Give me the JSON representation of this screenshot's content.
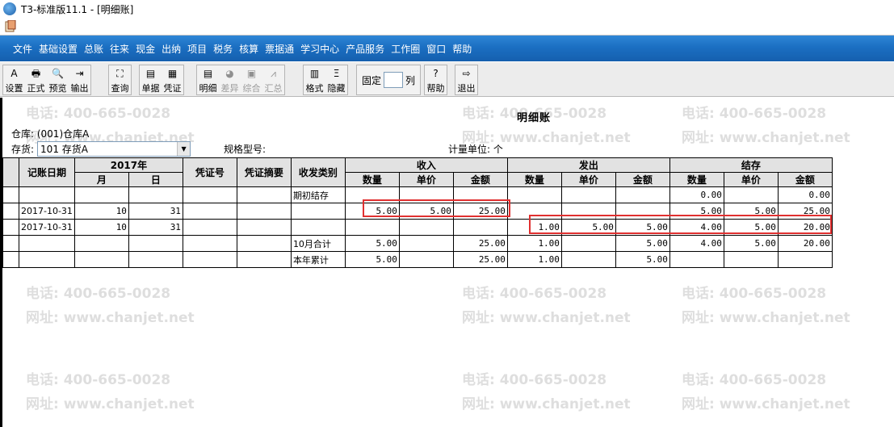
{
  "window": {
    "title": "T3-标准版11.1 - [明细账]"
  },
  "menu": [
    "文件",
    "基础设置",
    "总账",
    "往来",
    "现金",
    "出纳",
    "项目",
    "税务",
    "核算",
    "票据通",
    "学习中心",
    "产品服务",
    "工作圈",
    "窗口",
    "帮助"
  ],
  "toolbar": {
    "group1": [
      {
        "label": "设置",
        "icon": "A"
      },
      {
        "label": "正式",
        "icon": "🖶"
      },
      {
        "label": "预览",
        "icon": "🔍"
      },
      {
        "label": "输出",
        "icon": "⇥"
      }
    ],
    "group2": [
      {
        "label": "查询",
        "icon": "⛶"
      }
    ],
    "group3": [
      {
        "label": "单据",
        "icon": "▤"
      },
      {
        "label": "凭证",
        "icon": "▦"
      }
    ],
    "group4": [
      {
        "label": "明细",
        "icon": "▤"
      },
      {
        "label": "差异",
        "icon": "◕",
        "disabled": true
      },
      {
        "label": "综合",
        "icon": "▣",
        "disabled": true
      },
      {
        "label": "汇总",
        "icon": "⩘",
        "disabled": true
      }
    ],
    "group5": [
      {
        "label": "格式",
        "icon": "▥"
      },
      {
        "label": "隐藏",
        "icon": "Ξ"
      }
    ],
    "fixed": {
      "label": "固定",
      "suffix": "列",
      "value": ""
    },
    "group6": [
      {
        "label": "帮助",
        "icon": "?"
      }
    ],
    "group7": [
      {
        "label": "退出",
        "icon": "⇨"
      }
    ]
  },
  "report": {
    "title": "明细账",
    "warehouse_label": "仓库: (001)仓库A",
    "inventory_label": "存货:",
    "inventory_value": "101 存货A",
    "spec_label": "规格型号:",
    "unit_label": "计量单位: 个"
  },
  "table": {
    "headers": {
      "date": "记账日期",
      "year": "2017年",
      "month": "月",
      "day": "日",
      "voucher_no": "凭证号",
      "voucher_summary": "凭证摘要",
      "type": "收发类别",
      "in": "收入",
      "out": "发出",
      "balance": "结存",
      "qty": "数量",
      "price": "单价",
      "amount": "金额"
    },
    "rows": [
      {
        "date": "",
        "month": "",
        "day": "",
        "vno": "",
        "vsum": "",
        "type": "期初结存",
        "in_q": "",
        "in_p": "",
        "in_a": "",
        "out_q": "",
        "out_p": "",
        "out_a": "",
        "bal_q": "0.00",
        "bal_p": "",
        "bal_a": "0.00"
      },
      {
        "date": "2017-10-31",
        "month": "10",
        "day": "31",
        "vno": "",
        "vsum": "",
        "type": "",
        "in_q": "5.00",
        "in_p": "5.00",
        "in_a": "25.00",
        "out_q": "",
        "out_p": "",
        "out_a": "",
        "bal_q": "5.00",
        "bal_p": "5.00",
        "bal_a": "25.00"
      },
      {
        "date": "2017-10-31",
        "month": "10",
        "day": "31",
        "vno": "",
        "vsum": "",
        "type": "",
        "in_q": "",
        "in_p": "",
        "in_a": "",
        "out_q": "1.00",
        "out_p": "5.00",
        "out_a": "5.00",
        "bal_q": "4.00",
        "bal_p": "5.00",
        "bal_a": "20.00"
      },
      {
        "date": "",
        "month": "",
        "day": "",
        "vno": "",
        "vsum": "",
        "type": "10月合计",
        "in_q": "5.00",
        "in_p": "",
        "in_a": "25.00",
        "out_q": "1.00",
        "out_p": "",
        "out_a": "5.00",
        "bal_q": "4.00",
        "bal_p": "5.00",
        "bal_a": "20.00"
      },
      {
        "date": "",
        "month": "",
        "day": "",
        "vno": "",
        "vsum": "",
        "type": "本年累计",
        "in_q": "5.00",
        "in_p": "",
        "in_a": "25.00",
        "out_q": "1.00",
        "out_p": "",
        "out_a": "5.00",
        "bal_q": "",
        "bal_p": "",
        "bal_a": ""
      }
    ]
  },
  "watermark": {
    "phone": "电话: 400-665-0028",
    "site": "网址: www.chanjet.net"
  },
  "colors": {
    "menubar": "#1b6fc2",
    "highlight": "#e03030"
  }
}
